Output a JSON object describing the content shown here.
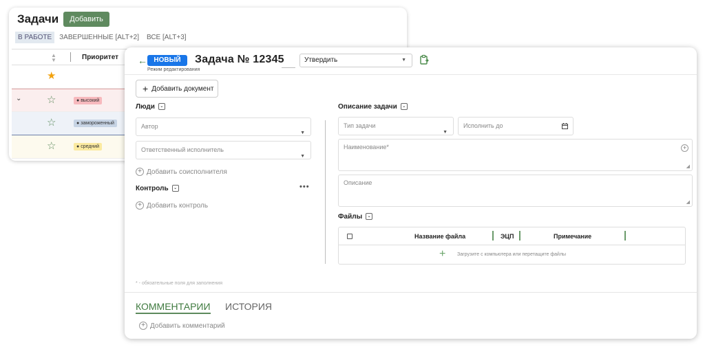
{
  "bg_list": {
    "title": "Задачи",
    "add_button": "Добавить",
    "tabs": [
      {
        "label": "В РАБОТЕ",
        "active": true
      },
      {
        "label": "ЗАВЕРШЕННЫЕ [ALT+2]",
        "active": false
      },
      {
        "label": "ВСЕ [ALT+3]",
        "active": false
      }
    ],
    "column_priority": "Приоритет",
    "rows": [
      {
        "star": "filled",
        "priority": ""
      },
      {
        "star": "outline",
        "priority": "высокий",
        "expanded": true
      },
      {
        "star": "outline",
        "priority": "замороженный"
      },
      {
        "star": "outline",
        "priority": "средний"
      }
    ],
    "colors": {
      "add_button": "#5f8a5f",
      "high": "#f7b9bd",
      "frozen": "#c6d3e4",
      "mid": "#fbeaa0",
      "star": "#f2a20f"
    }
  },
  "task": {
    "status": "НОВЫЙ",
    "mode": "Режим редактирования",
    "title": "Задача  №  12345",
    "action_select": "Утвердить",
    "add_document": "Добавить документ",
    "people": {
      "title": "Люди",
      "author_placeholder": "Автор",
      "executor_placeholder": "Ответственный исполнитель",
      "add_coexecutor": "Добавить соисполнителя"
    },
    "control": {
      "title": "Контроль",
      "add_control": "Добавить контроль"
    },
    "description": {
      "title": "Описание задачи",
      "type_placeholder": "Тип задачи",
      "due_placeholder": "Исполнить до",
      "name_placeholder": "Наименование*",
      "desc_placeholder": "Описание"
    },
    "files": {
      "title": "Файлы",
      "col_name": "Название файла",
      "col_ecp": "ЭЦП",
      "col_note": "Примечание",
      "upload_text": "Загрузите с компьютера или перетащите файлы"
    },
    "required_note": "* - обязательные поля для заполнения",
    "tabs": {
      "comments": "КОММЕНТАРИИ",
      "history": "ИСТОРИЯ"
    },
    "add_comment": "Добавить комментарий",
    "colors": {
      "status_badge": "#1976e8",
      "accent_green": "#3f7a3f"
    }
  }
}
